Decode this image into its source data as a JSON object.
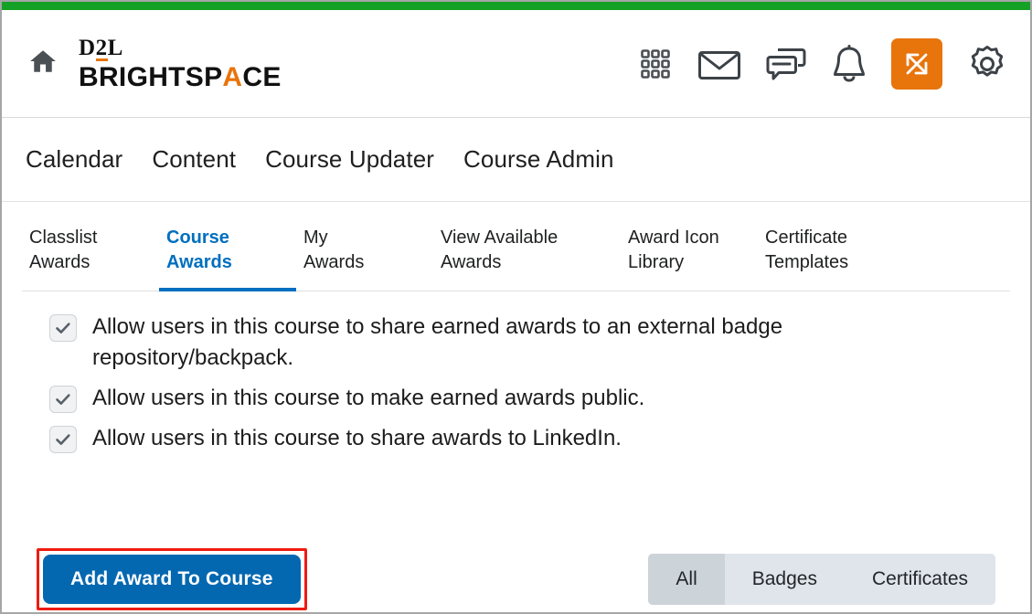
{
  "theme": {
    "accent_green": "#14a126",
    "brand_orange": "#e8740c",
    "link_blue": "#006fbf",
    "button_blue": "#0468b1",
    "highlight_red": "#ee1b11"
  },
  "header": {
    "home_icon": "home-icon",
    "brand": {
      "line1_a": "D",
      "line1_b": "2",
      "line1_c": "L",
      "line2_pre": "BRIGHTSP",
      "line2_accent": "A",
      "line2_post": "CE"
    },
    "icons": [
      {
        "name": "waffle-menu-icon",
        "label": "Course selector"
      },
      {
        "name": "envelope-icon",
        "label": "Email"
      },
      {
        "name": "chat-icon",
        "label": "Messages"
      },
      {
        "name": "bell-icon",
        "label": "Notifications"
      },
      {
        "name": "switch-arrows-icon",
        "label": "Switch"
      },
      {
        "name": "gear-icon",
        "label": "Settings"
      }
    ]
  },
  "course_nav": {
    "items": [
      {
        "label": "Calendar"
      },
      {
        "label": "Content"
      },
      {
        "label": "Course Updater"
      },
      {
        "label": "Course Admin"
      }
    ]
  },
  "tabs": {
    "items": [
      {
        "label": "Classlist\nAwards",
        "active": false
      },
      {
        "label": "Course\nAwards",
        "active": true
      },
      {
        "label": "My\nAwards",
        "active": false
      },
      {
        "label": "View Available\nAwards",
        "active": false
      },
      {
        "label": "Award Icon\nLibrary",
        "active": false
      },
      {
        "label": "Certificate\nTemplates",
        "active": false
      }
    ]
  },
  "settings": {
    "checkmark_glyph": "✔",
    "options": [
      {
        "label": "Allow users in this course to share earned awards to an external badge repository/backpack.",
        "checked": true
      },
      {
        "label": "Allow users in this course to make earned awards public.",
        "checked": true
      },
      {
        "label": "Allow users in this course to share awards to LinkedIn.",
        "checked": true
      }
    ]
  },
  "actions": {
    "primary_button": "Add Award To Course",
    "filters": [
      {
        "label": "All",
        "selected": true
      },
      {
        "label": "Badges",
        "selected": false
      },
      {
        "label": "Certificates",
        "selected": false
      }
    ]
  }
}
